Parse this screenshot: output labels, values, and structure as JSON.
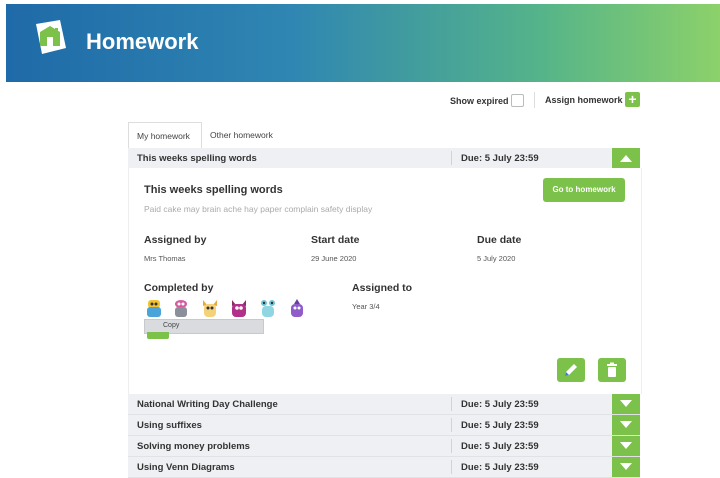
{
  "app": {
    "title": "Homework",
    "logo_icon": "homework-house-icon"
  },
  "toolbar": {
    "show_expired_label": "Show expired",
    "show_expired_checked": false,
    "assign_label": "Assign homework",
    "assign_icon": "plus-icon"
  },
  "tabs": [
    {
      "label": "My homework",
      "active": true
    },
    {
      "label": "Other homework",
      "active": false
    }
  ],
  "expanded": {
    "title": "This weeks spelling words",
    "due": "Due: 5 July 23:59",
    "detail_title": "This weeks spelling words",
    "description": "Paid cake may brain ache hay paper complain safety display",
    "go_button": "Go to homework",
    "assigned_by_label": "Assigned by",
    "assigned_by": "Mrs Thomas",
    "start_label": "Start date",
    "start_date": "29 June 2020",
    "due_label": "Due date",
    "due_date": "5 July 2020",
    "completed_label": "Completed by",
    "assigned_to_label": "Assigned to",
    "assigned_to": "Year 3/4",
    "copy_label": "Copy",
    "edit_icon": "pencil-icon",
    "delete_icon": "trash-icon"
  },
  "rows": [
    {
      "title": "National Writing Day Challenge",
      "due": "Due: 5 July 23:59"
    },
    {
      "title": "Using suffixes",
      "due": "Due: 5 July 23:59"
    },
    {
      "title": "Solving money problems",
      "due": "Due: 5 July 23:59"
    },
    {
      "title": "Using Venn Diagrams",
      "due": "Due: 5 July 23:59"
    }
  ],
  "colors": {
    "accent": "#7cc24a",
    "header_start": "#1f6aa8",
    "header_end": "#8cd16a"
  }
}
